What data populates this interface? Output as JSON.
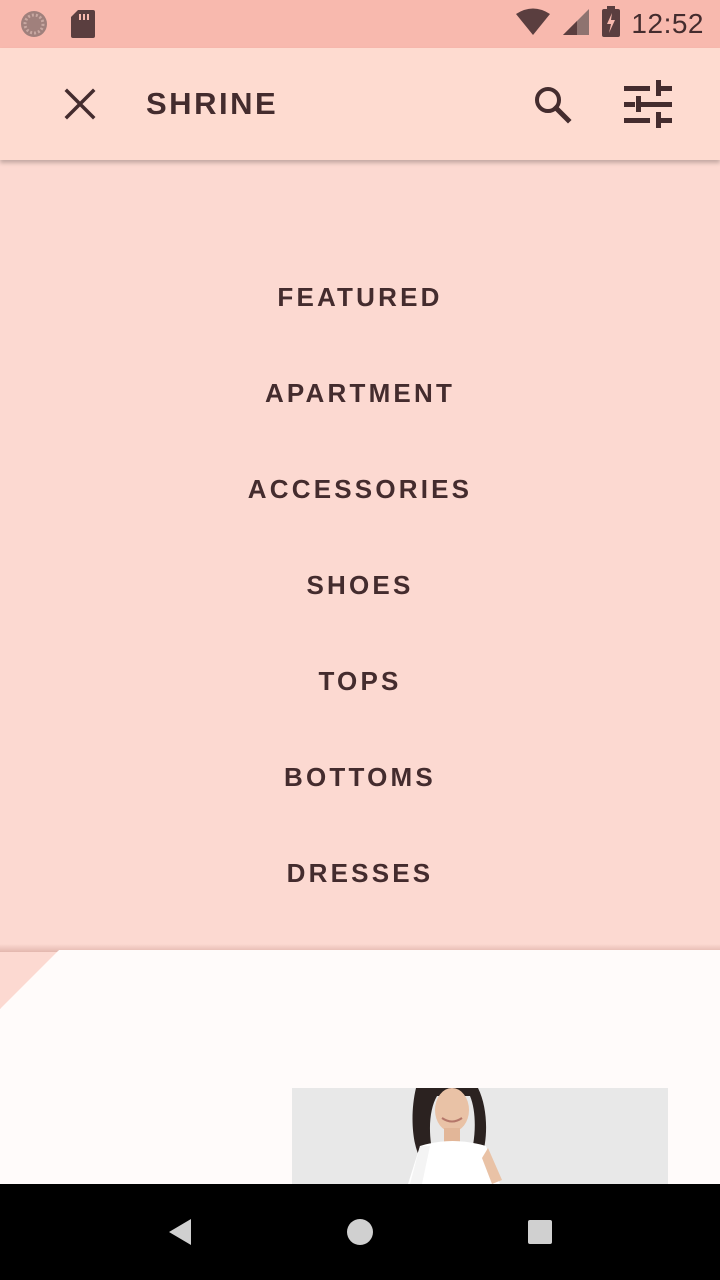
{
  "status_bar": {
    "time": "12:52",
    "icons": [
      "settings-notification-icon",
      "sd-card-icon",
      "wifi-icon",
      "signal-icon",
      "battery-charging-icon"
    ]
  },
  "app_bar": {
    "title": "SHRINE",
    "close_icon": "close-icon",
    "search_icon": "search-icon",
    "filter_icon": "tune-icon"
  },
  "menu": {
    "items": [
      "FEATURED",
      "APARTMENT",
      "ACCESSORIES",
      "SHOES",
      "TOPS",
      "BOTTOMS",
      "DRESSES"
    ]
  },
  "colors": {
    "primary": "#fedbd0",
    "status_bar": "#f8b9ae",
    "on_primary": "#442c2e",
    "surface": "#fffbfa"
  },
  "nav_bar": {
    "icons": [
      "back-icon",
      "home-icon",
      "recents-icon"
    ]
  }
}
